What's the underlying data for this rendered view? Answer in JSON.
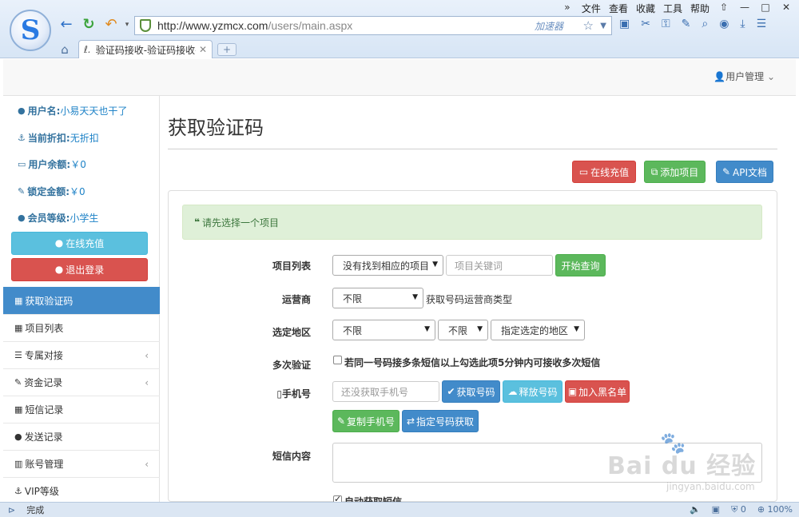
{
  "browser": {
    "menu": [
      "文件",
      "查看",
      "收藏",
      "工具",
      "帮助"
    ],
    "url": "http://www.yzmcx.com",
    "url_path": "/users/main.aspx",
    "accelerator": "加速器",
    "tab_title": "验证码接收-验证码接收平",
    "logo_letter": "S",
    "status_text": "完成",
    "status_count": "0",
    "zoom": "100%"
  },
  "topbar": {
    "user_menu": "用户管理"
  },
  "sidebar": {
    "info": [
      {
        "label": "用户名:",
        "value": "小易天天也干了",
        "icon": "user-icon"
      },
      {
        "label": "当前折扣:",
        "value": "无折扣",
        "icon": "anchor-icon"
      },
      {
        "label": "用户余额:",
        "value": "￥0",
        "icon": "wallet-icon"
      },
      {
        "label": "锁定金额:",
        "value": "￥0",
        "icon": "lock-icon"
      },
      {
        "label": "会员等级:",
        "value": "小学生",
        "icon": "apple-icon"
      }
    ],
    "recharge": "在线充值",
    "logout": "退出登录",
    "nav": [
      {
        "label": "获取验证码",
        "active": true
      },
      {
        "label": "项目列表"
      },
      {
        "label": "专属对接",
        "chevron": true
      },
      {
        "label": "资金记录",
        "chevron": true
      },
      {
        "label": "短信记录"
      },
      {
        "label": "发送记录"
      },
      {
        "label": "账号管理",
        "chevron": true
      },
      {
        "label": "VIP等级"
      }
    ]
  },
  "main": {
    "title": "获取验证码",
    "actions": {
      "recharge": "在线充值",
      "add_project": "添加项目",
      "api_doc": "API文档"
    },
    "alert": "请先选择一个项目",
    "form": {
      "project_label": "项目列表",
      "project_select": "没有找到相应的项目",
      "project_keyword_placeholder": "项目关键词",
      "search_btn": "开始查询",
      "carrier_label": "运营商",
      "carrier_select": "不限",
      "carrier_hint": "获取号码运营商类型",
      "region_label": "选定地区",
      "region_province": "不限",
      "region_city": "不限",
      "region_specify": "指定选定的地区",
      "multi_label": "多次验证",
      "multi_hint": "若同一号码接多条短信以上勾选此项5分钟内可接收多次短信",
      "phone_label": "手机号",
      "phone_placeholder": "还没获取手机号",
      "get_number": "获取号码",
      "release_number": "释放号码",
      "blacklist": "加入黑名单",
      "copy_phone": "复制手机号",
      "specify_number": "指定号码获取",
      "sms_label": "短信内容",
      "auto_get": "自动获取短信"
    }
  },
  "watermark": {
    "brand": "Bai du 经验",
    "sub": "jingyan.baidu.com"
  }
}
